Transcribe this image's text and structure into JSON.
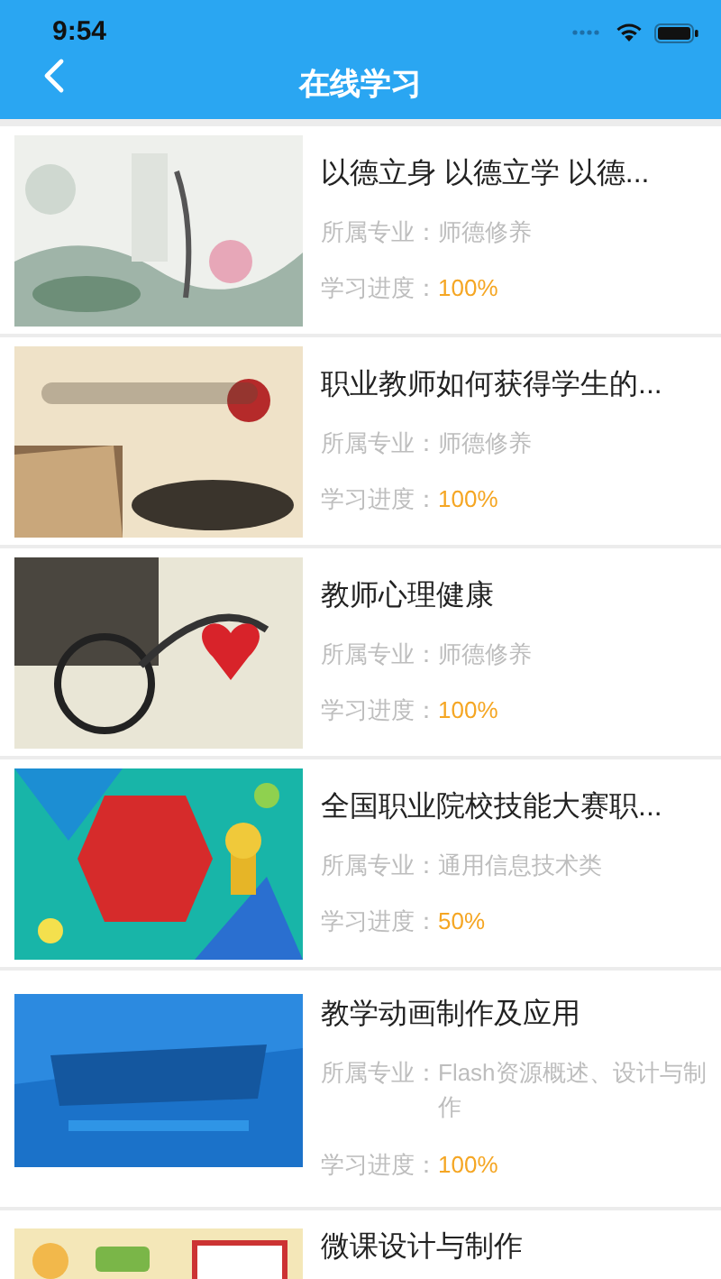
{
  "status_bar": {
    "time": "9:54"
  },
  "nav": {
    "title": "在线学习"
  },
  "courses": [
    {
      "title": "以德立身 以德立学 以德...",
      "major_label": "所属专业：",
      "major": "师德修养",
      "progress_label": "学习进度：",
      "progress": "100%"
    },
    {
      "title": "职业教师如何获得学生的...",
      "major_label": "所属专业：",
      "major": "师德修养",
      "progress_label": "学习进度：",
      "progress": "100%"
    },
    {
      "title": "教师心理健康",
      "major_label": "所属专业：",
      "major": "师德修养",
      "progress_label": "学习进度：",
      "progress": "100%"
    },
    {
      "title": "全国职业院校技能大赛职...",
      "major_label": "所属专业：",
      "major": "通用信息技术类",
      "progress_label": "学习进度：",
      "progress": "50%"
    },
    {
      "title": "教学动画制作及应用",
      "major_label": "所属专业：",
      "major": "Flash资源概述、设计与制作",
      "progress_label": "学习进度：",
      "progress": "100%"
    },
    {
      "title": "微课设计与制作"
    }
  ]
}
